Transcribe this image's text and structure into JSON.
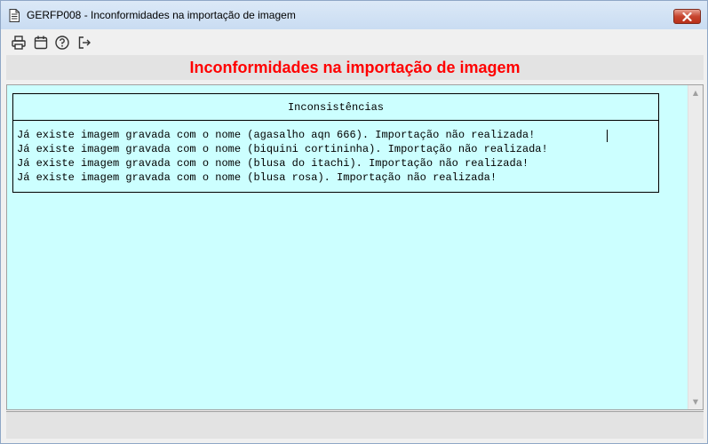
{
  "window": {
    "title": "GERFP008 - Inconformidades na importação de imagem",
    "close_icon": "close-icon"
  },
  "toolbar": {
    "buttons": [
      {
        "icon": "printer-icon"
      },
      {
        "icon": "calendar-icon"
      },
      {
        "icon": "help-icon"
      },
      {
        "icon": "exit-icon"
      }
    ]
  },
  "header": {
    "title": "Inconformidades na importação de imagem",
    "title_color": "#ff0000"
  },
  "content": {
    "background": "#ccffff",
    "panel": {
      "heading": "Inconsistências",
      "lines": [
        "Já existe imagem gravada com o nome (agasalho aqn 666). Importação não realizada!",
        "Já existe imagem gravada com o nome (biquini cortininha). Importação não realizada!",
        "Já existe imagem gravada com o nome (blusa do itachi). Importação não realizada!",
        "Já existe imagem gravada com o nome (blusa rosa). Importação não realizada!"
      ]
    }
  }
}
